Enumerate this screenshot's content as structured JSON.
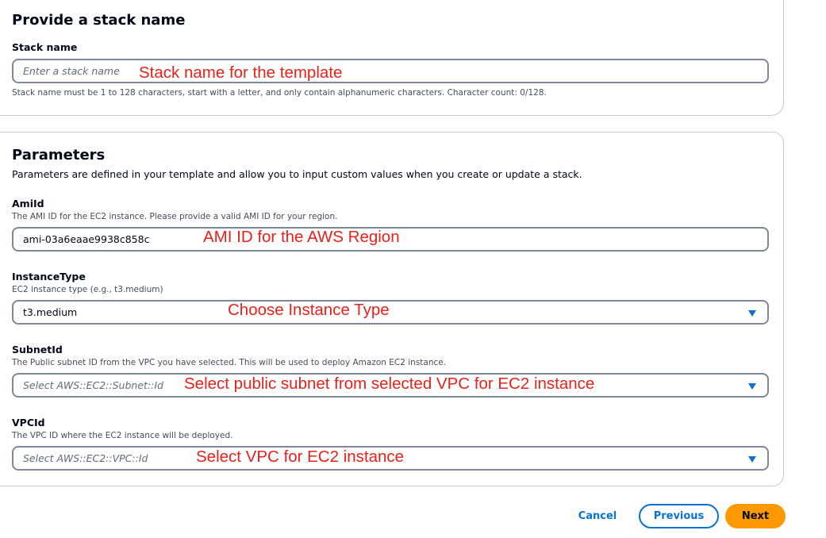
{
  "stack_section": {
    "title": "Provide a stack name",
    "field_label": "Stack name",
    "placeholder": "Enter a stack name",
    "hint": "Stack name must be 1 to 128 characters, start with a letter, and only contain alphanumeric characters. Character count: 0/128.",
    "annotation": "Stack name for the template"
  },
  "parameters": {
    "title": "Parameters",
    "description": "Parameters are defined in your template and allow you to input custom values when you create or update a stack.",
    "ami": {
      "label": "AmiId",
      "sub": "The AMI ID for the EC2 instance. Please provide a valid AMI ID for your region.",
      "value": "ami-03a6eaae9938c858c",
      "annotation": "AMI ID for the AWS Region"
    },
    "instance_type": {
      "label": "InstanceType",
      "sub": "EC2 instance type (e.g., t3.medium)",
      "value": "t3.medium",
      "annotation": "Choose Instance Type"
    },
    "subnet": {
      "label": "SubnetId",
      "sub": "The Public subnet ID from the VPC you have selected. This will be used to deploy Amazon EC2 instance.",
      "placeholder": "Select AWS::EC2::Subnet::Id",
      "annotation": "Select public subnet from selected VPC for EC2 instance"
    },
    "vpc": {
      "label": "VPCId",
      "sub": "The VPC ID where the EC2 instance will be deployed.",
      "placeholder": "Select AWS::EC2::VPC::Id",
      "annotation": "Select VPC for EC2 instance"
    }
  },
  "footer": {
    "cancel": "Cancel",
    "previous": "Previous",
    "next": "Next"
  },
  "colors": {
    "accent": "#0972d3",
    "primary_button": "#ff9900",
    "annotation": "#e8211a"
  }
}
